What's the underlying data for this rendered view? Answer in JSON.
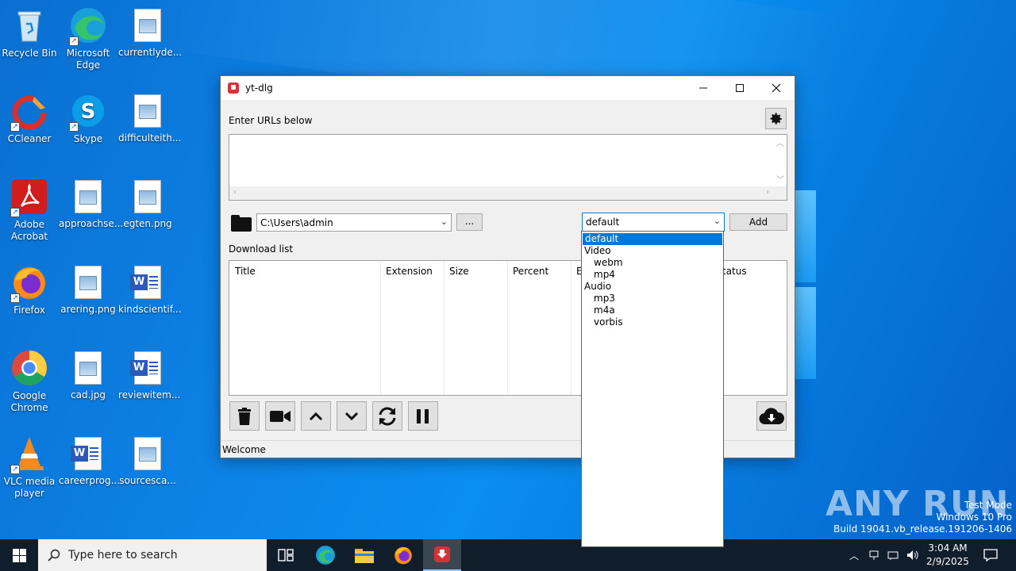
{
  "desktop": {
    "icons": [
      {
        "label": "Recycle Bin"
      },
      {
        "label": "Microsoft Edge"
      },
      {
        "label": "currentlyde..."
      },
      {
        "label": "CCleaner"
      },
      {
        "label": "Skype"
      },
      {
        "label": "difficulteith..."
      },
      {
        "label": "Adobe Acrobat"
      },
      {
        "label": "approachse..."
      },
      {
        "label": "egten.png"
      },
      {
        "label": "Firefox"
      },
      {
        "label": "arering.png"
      },
      {
        "label": "kindscientif..."
      },
      {
        "label": "Google Chrome"
      },
      {
        "label": "cad.jpg"
      },
      {
        "label": "reviewitem..."
      },
      {
        "label": "VLC media player"
      },
      {
        "label": "careerprog..."
      },
      {
        "label": "sourcesca..."
      }
    ]
  },
  "window": {
    "title": "yt-dlg",
    "urls_label": "Enter URLs below",
    "path_value": "C:\\Users\\admin",
    "browse_label": "...",
    "format_value": "default",
    "add_label": "Add",
    "download_list_label": "Download list",
    "columns": [
      "Title",
      "Extension",
      "Size",
      "Percent",
      "E",
      "tatus"
    ],
    "status_text": "Welcome"
  },
  "format_dropdown": {
    "options": [
      {
        "label": "default",
        "selected": true,
        "child": false
      },
      {
        "label": "Video",
        "selected": false,
        "child": false
      },
      {
        "label": "webm",
        "selected": false,
        "child": true
      },
      {
        "label": "mp4",
        "selected": false,
        "child": true
      },
      {
        "label": "Audio",
        "selected": false,
        "child": false
      },
      {
        "label": "mp3",
        "selected": false,
        "child": true
      },
      {
        "label": "m4a",
        "selected": false,
        "child": true
      },
      {
        "label": "vorbis",
        "selected": false,
        "child": true
      }
    ]
  },
  "watermark": {
    "brand": "ANY RUN",
    "line1": "Test Mode",
    "line2": "Windows 10 Pro",
    "line3": "Build 19041.vb_release.191206-1406"
  },
  "taskbar": {
    "search_placeholder": "Type here to search",
    "time": "3:04 AM",
    "date": "2/9/2025"
  },
  "colors": {
    "accent": "#0078d7",
    "taskbar": "#101d2b",
    "window_bg": "#f0f0f0"
  }
}
